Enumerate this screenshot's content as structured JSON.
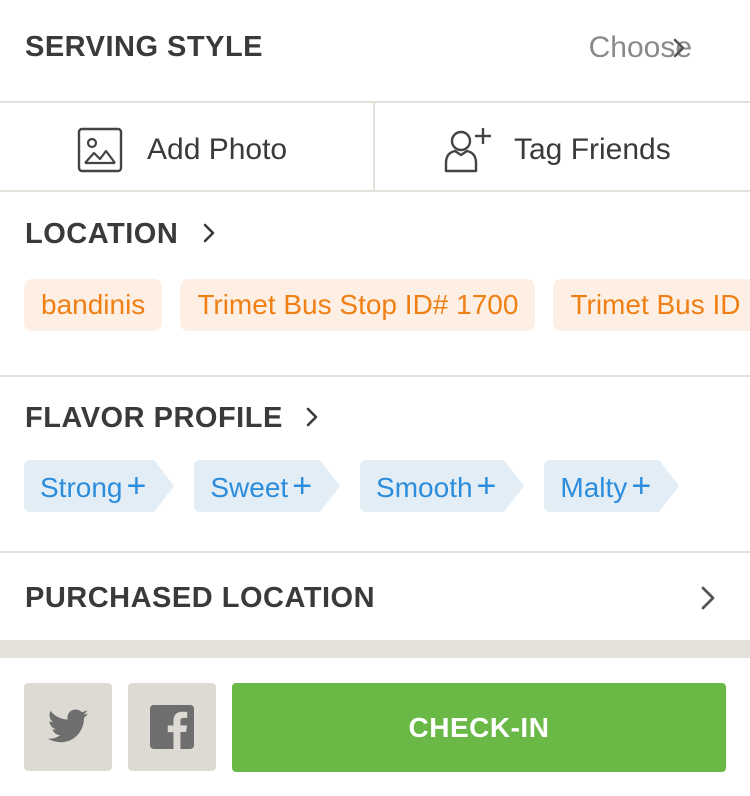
{
  "serving_style": {
    "title": "SERVING STYLE",
    "value": "Choose"
  },
  "actions": {
    "add_photo": "Add Photo",
    "tag_friends": "Tag Friends"
  },
  "location": {
    "title": "LOCATION",
    "chips": [
      "bandinis",
      "Trimet Bus Stop ID# 1700",
      "Trimet Bus ID"
    ]
  },
  "flavor_profile": {
    "title": "FLAVOR PROFILE",
    "chips": [
      "Strong",
      "Sweet",
      "Smooth",
      "Malty"
    ],
    "add_symbol": "+"
  },
  "purchased_location": {
    "title": "PURCHASED LOCATION"
  },
  "footer": {
    "checkin_label": "CHECK-IN"
  },
  "colors": {
    "location_chip_bg": "#fdefe4",
    "location_chip_text": "#f07f14",
    "flavor_chip_bg": "#e3edf6",
    "flavor_chip_text": "#2b8ddc",
    "checkin_bg": "#6ab947",
    "share_bg": "#dcdad3"
  },
  "icons": {
    "photo": "image-icon",
    "tag": "add-person-icon",
    "twitter": "twitter-icon",
    "facebook": "facebook-icon",
    "chevron": "chevron-right-icon"
  }
}
